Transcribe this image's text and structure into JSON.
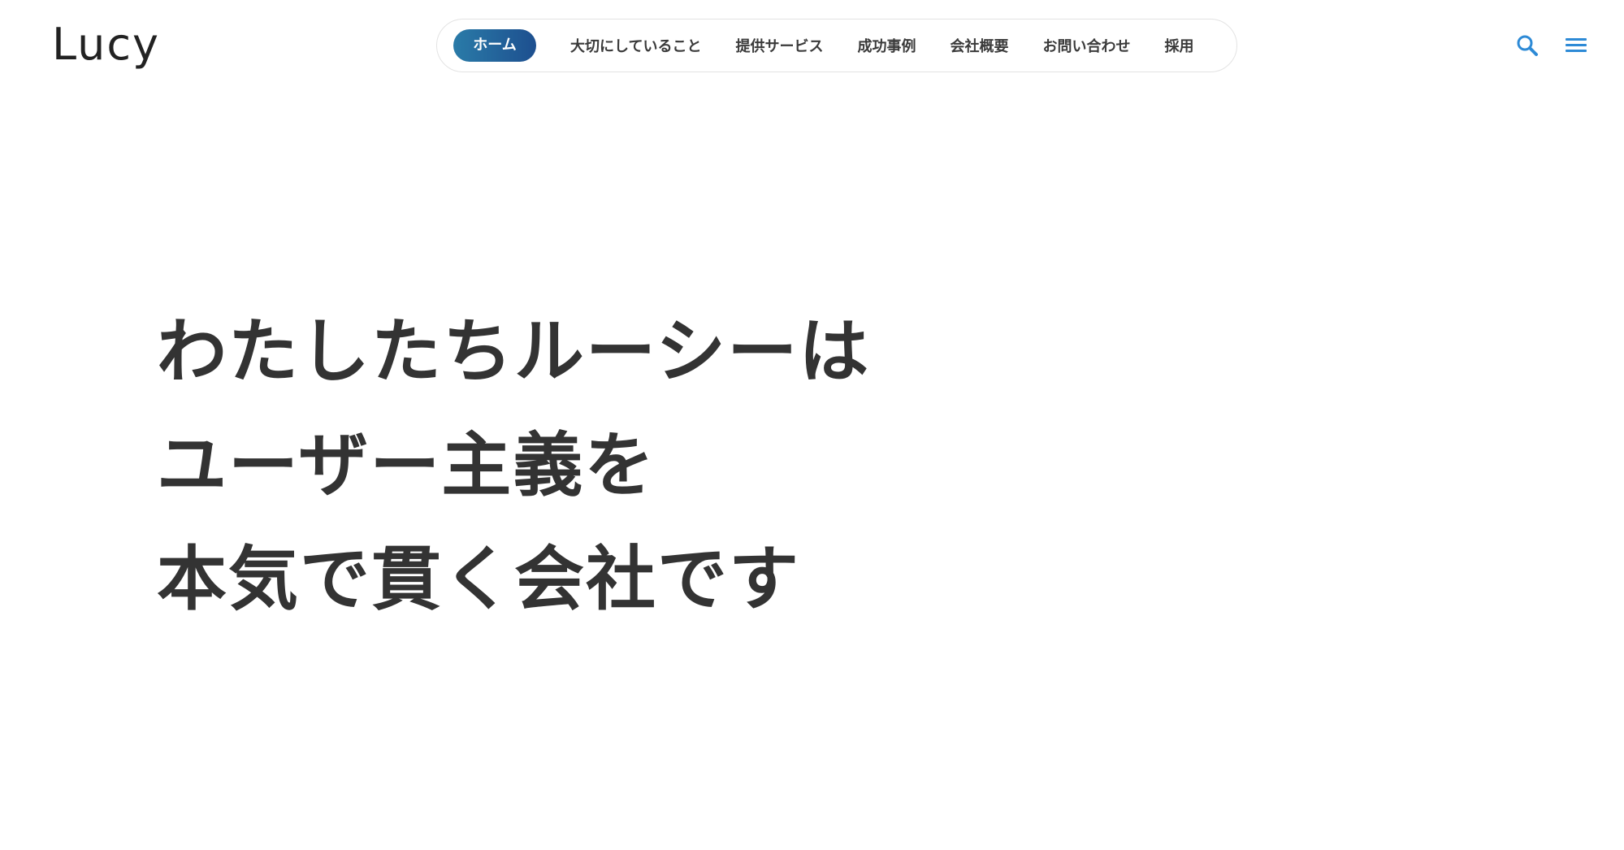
{
  "header": {
    "logo": "Lucy",
    "nav": [
      {
        "label": "ホーム",
        "active": true
      },
      {
        "label": "大切にしていること",
        "active": false
      },
      {
        "label": "提供サービス",
        "active": false
      },
      {
        "label": "成功事例",
        "active": false
      },
      {
        "label": "会社概要",
        "active": false
      },
      {
        "label": "お問い合わせ",
        "active": false
      },
      {
        "label": "採用",
        "active": false
      }
    ],
    "icons": {
      "search": "search-icon",
      "menu": "hamburger-menu-icon"
    },
    "colors": {
      "accent": "#2d8ad6",
      "active_start": "#2a7ba8",
      "active_end": "#1d4f8f"
    }
  },
  "hero": {
    "lines": [
      "わたしたちルーシーは",
      "ユーザー主義を",
      "本気で貫く会社です"
    ]
  }
}
